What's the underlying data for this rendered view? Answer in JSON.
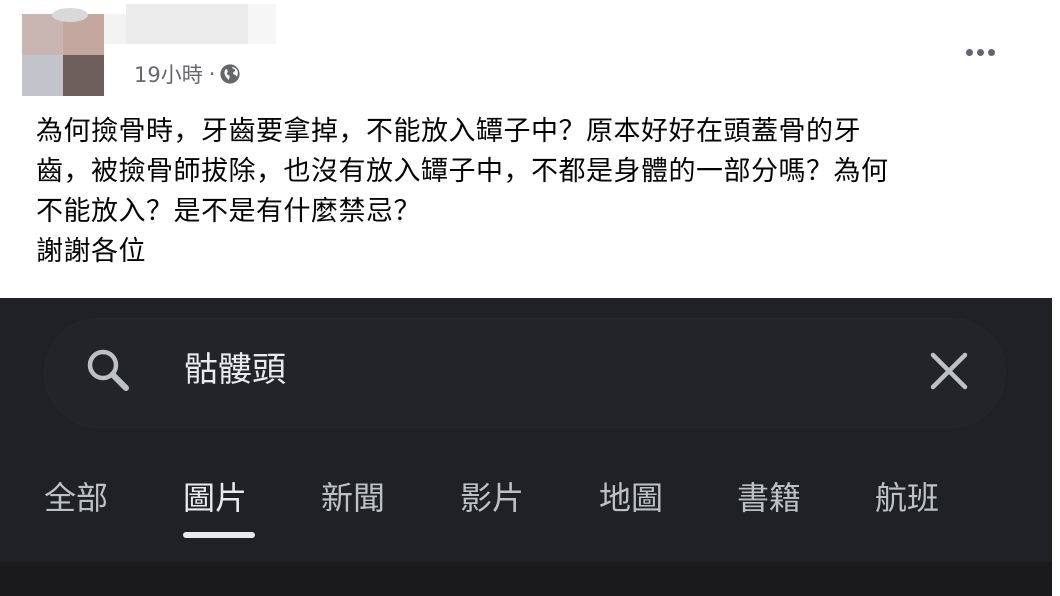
{
  "post": {
    "timestamp": "19小時",
    "separator": "·",
    "privacy_icon": "globe-icon",
    "more_icon": "more-horizontal-icon",
    "body_lines": [
      "為何撿骨時，牙齒要拿掉，不能放入罈子中？原本好好在頭蓋骨的牙",
      "齒，被撿骨師拔除，也沒有放入罈子中，不都是身體的一部分嗎？為何",
      "不能放入？是不是有什麼禁忌？",
      "謝謝各位"
    ]
  },
  "search": {
    "query": "骷髏頭",
    "search_icon": "search-icon",
    "clear_icon": "close-icon",
    "tabs": [
      {
        "label": "全部",
        "active": false
      },
      {
        "label": "圖片",
        "active": true
      },
      {
        "label": "新聞",
        "active": false
      },
      {
        "label": "影片",
        "active": false
      },
      {
        "label": "地圖",
        "active": false
      },
      {
        "label": "書籍",
        "active": false
      },
      {
        "label": "航班",
        "active": false
      }
    ]
  },
  "colors": {
    "post_background": "#ffffff",
    "meta_text": "#65676b",
    "dark_background": "#202124",
    "search_text": "#e8eaed",
    "tab_text": "#bdc1c6"
  }
}
